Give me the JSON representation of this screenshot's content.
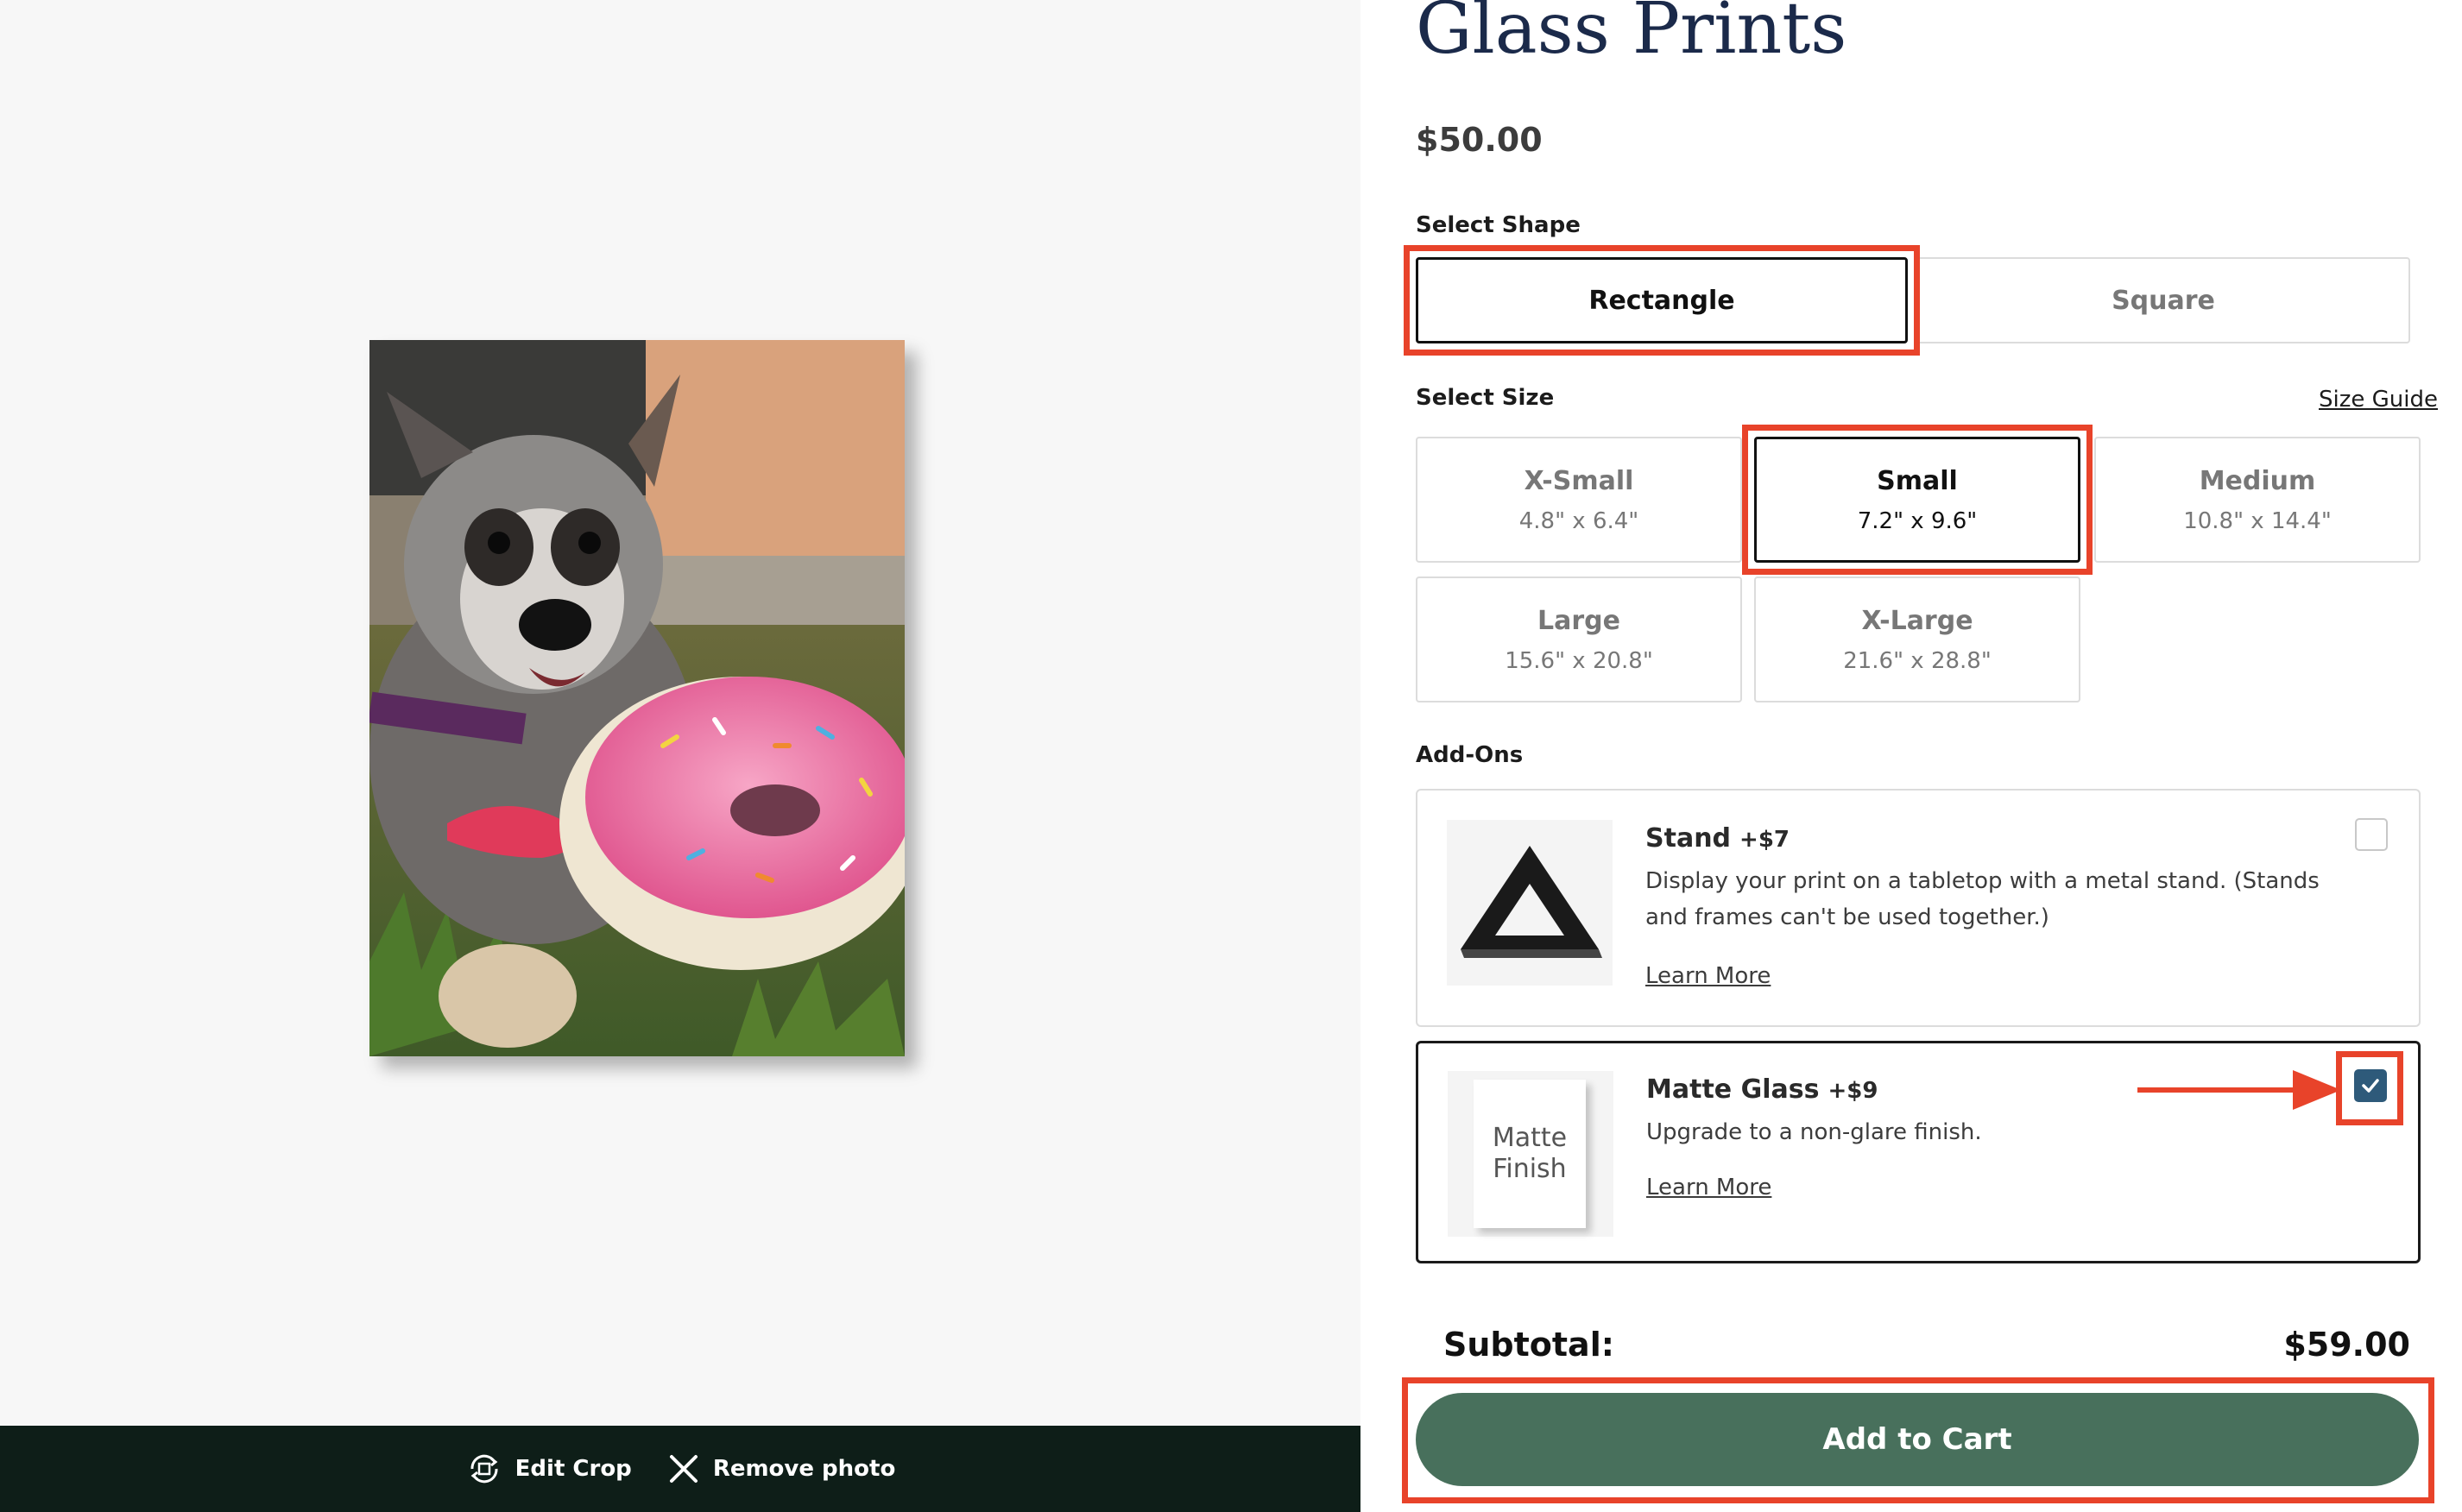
{
  "product": {
    "title": "Glass Prints",
    "price": "$50.00"
  },
  "shape": {
    "label": "Select Shape",
    "options": [
      {
        "label": "Rectangle",
        "selected": true
      },
      {
        "label": "Square",
        "selected": false
      }
    ]
  },
  "size": {
    "label": "Select Size",
    "guide_link": "Size Guide",
    "options": [
      {
        "label": "X-Small",
        "dims": "4.8\" x 6.4\"",
        "selected": false
      },
      {
        "label": "Small",
        "dims": "7.2\" x 9.6\"",
        "selected": true
      },
      {
        "label": "Medium",
        "dims": "10.8\" x 14.4\"",
        "selected": false
      },
      {
        "label": "Large",
        "dims": "15.6\" x 20.8\"",
        "selected": false
      },
      {
        "label": "X-Large",
        "dims": "21.6\" x 28.8\"",
        "selected": false
      }
    ]
  },
  "addons": {
    "label": "Add-Ons",
    "items": [
      {
        "title": "Stand",
        "price": "+$7",
        "description": "Display your print on a tabletop with a metal stand. (Stands and frames can't be used together.)",
        "link": "Learn More",
        "checked": false,
        "icon": "stand-icon"
      },
      {
        "title": "Matte Glass",
        "price": "+$9",
        "description": "Upgrade to a non-glare finish.",
        "link": "Learn More",
        "checked": true,
        "thumb_text_1": "Matte",
        "thumb_text_2": "Finish",
        "icon": "matte-finish-icon"
      }
    ]
  },
  "cart": {
    "subtotal_label": "Subtotal:",
    "subtotal_value": "$59.00",
    "add_to_cart": "Add to Cart"
  },
  "preview": {
    "edit_crop": "Edit Crop",
    "remove_photo": "Remove photo",
    "photo_icon": "puppy-with-donut-toy-photo"
  },
  "colors": {
    "accent_highlight": "#e8432a",
    "cart_button": "#48705c",
    "title_navy": "#1b2a4a",
    "checkbox_checked": "#2e5a7a",
    "bottom_bar": "#0e1e18"
  }
}
